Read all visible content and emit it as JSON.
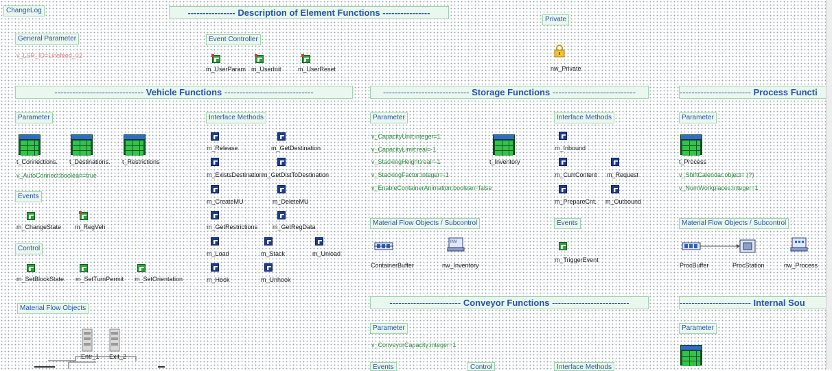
{
  "changelog": "ChangeLog",
  "description": "---------------- Description of Element Functions ----------------",
  "private": {
    "header": "Private",
    "icon": "lock-icon",
    "label": "nw_Private"
  },
  "general": {
    "header": "General Parameter",
    "var": "v_LSR_ID=Linefeed_02"
  },
  "event_controller": {
    "header": "Event Controller",
    "items": [
      "m_UserParam",
      "m_UserInit",
      "m_UserReset"
    ]
  },
  "vehicle": {
    "section_dashes_left": "------------------------------",
    "section_title": "Vehicle Functions",
    "section_dashes_right": "------------------------------",
    "parameter_header": "Parameter",
    "tables": [
      "t_Connections.",
      "t_Destinations.",
      "t_Restrictions"
    ],
    "autoconnect": "v_AutoConnect:boolean=true",
    "events_header": "Events",
    "events": [
      "m_ChangeState",
      "m_RegVeh"
    ],
    "control_header": "Control",
    "control": [
      "m_SetBlockState.",
      "m_SetTurnPermit",
      "m_SetOrientation"
    ],
    "mfo_header": "Material Flow Objects",
    "mfo_labels": [
      "Entr_1",
      "Exit_2"
    ],
    "interface_header": "Interface Methods",
    "interface": [
      "m_Release",
      "m_GetDestination",
      "m_ExistsDestination",
      "m_GetDistToDestination",
      "m_CreateMU",
      "m_DeleteMU",
      "m_GetRestrictions",
      "m_GetRegData",
      "m_Load",
      "m_Stack",
      "m_Unload",
      "m_Hook",
      "m_Unhook"
    ]
  },
  "storage": {
    "section_dashes_left": "-----------------------------",
    "section_title": "Storage Functions",
    "section_dashes_right": "----------------------------",
    "parameter_header": "Parameter",
    "vars": [
      "v_CapacityUnit:integer=1",
      "v_CapacityLimit:real=-1",
      "v_StackingHeight:real=-1",
      "v_StackingFactor:integer=-1",
      "v_EnableContainerAnimation:boolean=false"
    ],
    "table": "t_Inventory",
    "interface_header": "Interface Methods",
    "interface": [
      "m_Inbound",
      "m_CurrContent",
      "m_Request",
      "m_PrepareCnt.",
      "m_Outbound"
    ],
    "mfo_header": "Material Flow Objects / Subcontrol",
    "mfo": [
      "ContainerBuffer",
      "nw_Inventory"
    ],
    "inventory_badge": "INV",
    "events_header": "Events",
    "events": [
      "m_TriggerEvent"
    ]
  },
  "process": {
    "section_dashes_left": "------------------------",
    "section_title": "Process Functi",
    "parameter_header": "Parameter",
    "table": "t_Process",
    "vars": [
      "v_ShiftCalendar:object= (?)",
      "v_NumWorkplaces:integer=1"
    ],
    "mfo_header": "Material Flow Objects / Subcontrol",
    "mfo": [
      "ProcBuffer",
      "ProcStation",
      "nw_Process"
    ]
  },
  "conveyor": {
    "section_dashes_left": "------------------------",
    "section_title": "Conveyor Functions",
    "section_dashes_right": "--------------------------",
    "parameter_header": "Parameter",
    "var": "v_ConveyorCapacity:integer=1",
    "partial_headers": [
      "Events",
      "Control",
      "Interface Methods"
    ]
  },
  "internal": {
    "section_dashes_left": "------------------------",
    "section_title": "Internal Sou",
    "parameter_header": "Parameter"
  }
}
